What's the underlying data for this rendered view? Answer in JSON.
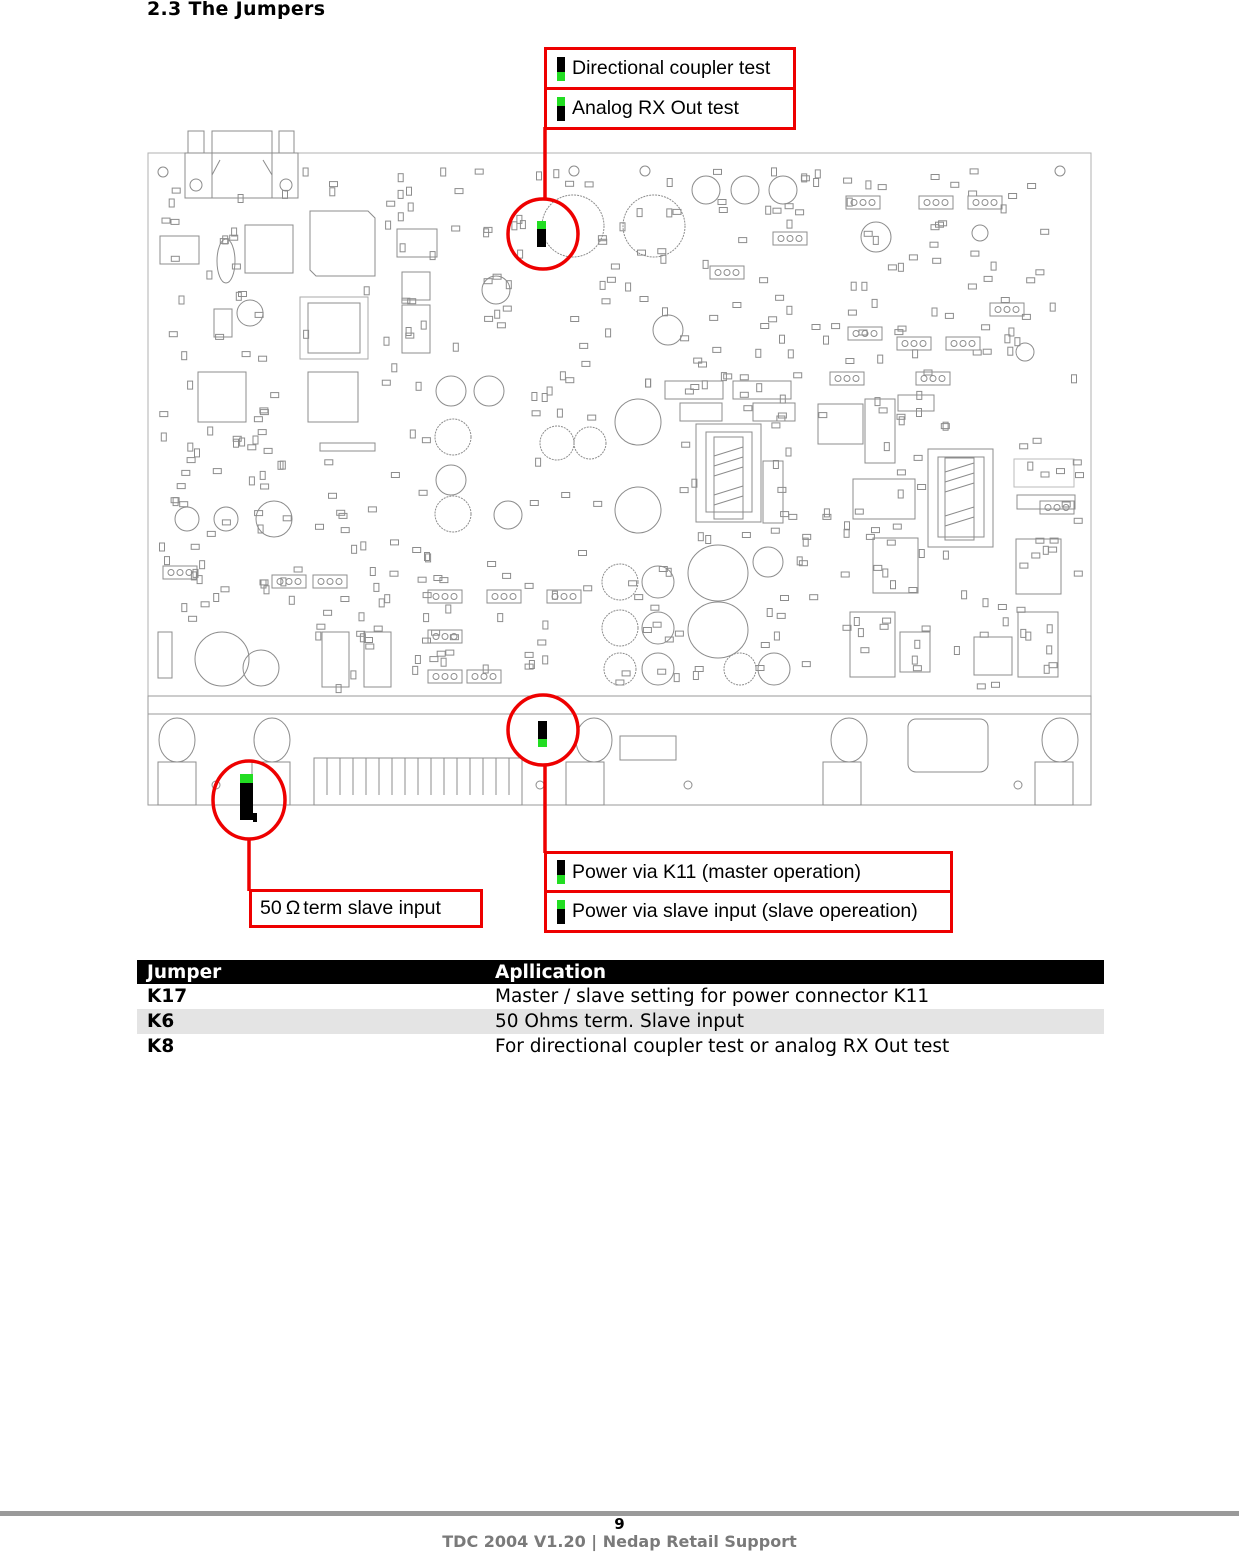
{
  "section": {
    "title": "2.3 The Jumpers"
  },
  "figure": {
    "description": "PCB layout with jumper locations",
    "callouts": {
      "k8_option_a": {
        "label": "Directional coupler test",
        "jumper_state": "green-bottom"
      },
      "k8_option_b": {
        "label": "Analog RX Out test",
        "jumper_state": "green-top"
      },
      "k17_option_a": {
        "label": "Power via K11 (master operation)",
        "jumper_state": "green-bottom"
      },
      "k17_option_b": {
        "label": "Power via slave input (slave opereation)",
        "jumper_state": "green-top"
      },
      "k6": {
        "label_prefix": "50",
        "symbol": "Ω",
        "label_suffix": "term slave input"
      }
    },
    "colors": {
      "highlight": "#ee0000",
      "jumper_body": "#000000",
      "jumper_cap": "#22dd22",
      "board_lines": "#8c8c8c"
    }
  },
  "table": {
    "headers": [
      "Jumper",
      "Apllication"
    ],
    "rows": [
      {
        "jumper": "K17",
        "application": "Master / slave setting for power connector K11"
      },
      {
        "jumper": "K6",
        "application": "50 Ohms term. Slave input"
      },
      {
        "jumper": "K8",
        "application": "For directional coupler test or analog RX Out test"
      }
    ]
  },
  "footer": {
    "page_number": "9",
    "text": "TDC 2004 V1.20 | Nedap Retail Support"
  }
}
